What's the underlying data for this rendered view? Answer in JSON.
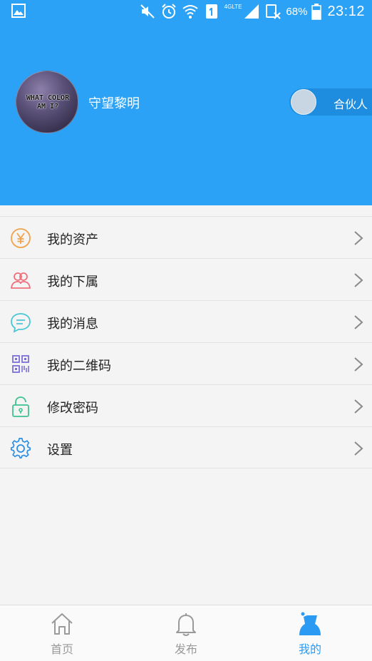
{
  "status_bar": {
    "lte": "4GLTE",
    "battery": "68%",
    "time": "23:12"
  },
  "profile": {
    "avatar_text_line1": "WHAT COLOR",
    "avatar_text_line2": "AM I?",
    "username": "守望黎明",
    "partner_label": "合伙人"
  },
  "menu": {
    "items": [
      {
        "label": "我的资产",
        "icon": "yen-coin-icon",
        "color": "#f0a34a"
      },
      {
        "label": "我的下属",
        "icon": "users-icon",
        "color": "#ef6f7d"
      },
      {
        "label": "我的消息",
        "icon": "message-bubble-icon",
        "color": "#48c7d4"
      },
      {
        "label": "我的二维码",
        "icon": "qr-code-icon",
        "color": "#7b6fd6"
      },
      {
        "label": "修改密码",
        "icon": "lock-icon",
        "color": "#3ec28f"
      },
      {
        "label": "设置",
        "icon": "gear-icon",
        "color": "#2b8fe6"
      }
    ]
  },
  "tabbar": {
    "tabs": [
      {
        "label": "首页",
        "icon": "home-icon"
      },
      {
        "label": "发布",
        "icon": "bell-icon"
      },
      {
        "label": "我的",
        "icon": "person-icon",
        "active": true
      }
    ]
  },
  "colors": {
    "header_bg": "#2ba2f6",
    "active_tab": "#2b9af3"
  }
}
